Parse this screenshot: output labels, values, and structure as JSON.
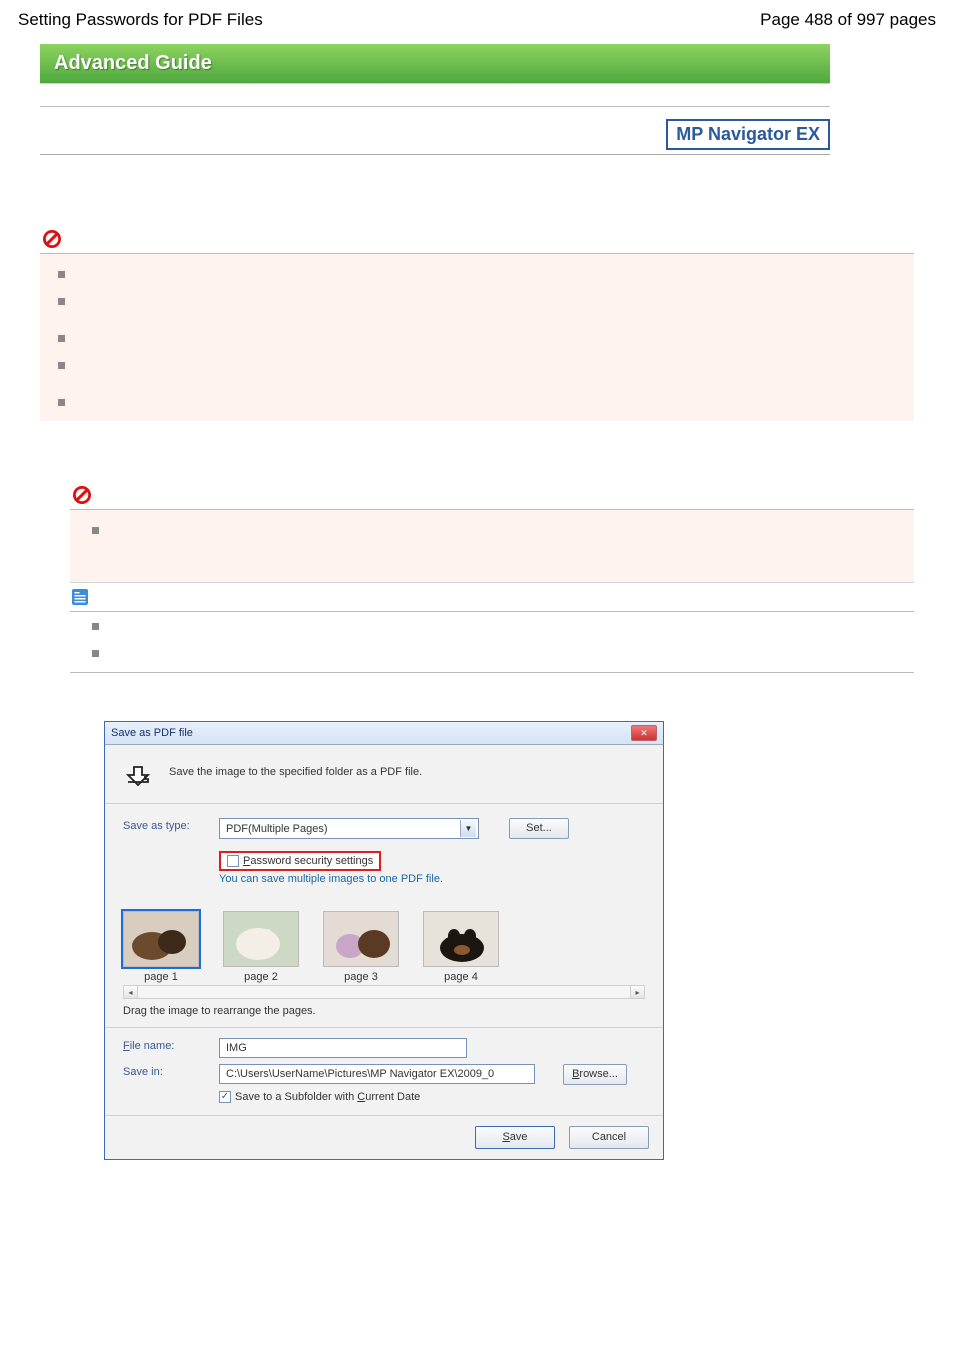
{
  "header": {
    "title": "Setting Passwords for PDF Files",
    "page_of": "Page 488 of 997 pages"
  },
  "banner": {
    "advanced_guide": "Advanced Guide",
    "mp_nav": "MP Navigator EX"
  },
  "dialog": {
    "title": "Save as PDF file",
    "header_text": "Save the image to the specified folder as a PDF file.",
    "save_as_type_label": "Save as type:",
    "save_as_type_value": "PDF(Multiple Pages)",
    "set_button": "Set...",
    "password_checkbox": "Password security settings",
    "multiple_hint": "You can save multiple images to one PDF file.",
    "pages": [
      "page 1",
      "page 2",
      "page 3",
      "page 4"
    ],
    "drag_hint": "Drag the image to rearrange the pages.",
    "file_name_label": "File name:",
    "file_name_value": "IMG",
    "save_in_label": "Save in:",
    "save_in_value": "C:\\Users\\UserName\\Pictures\\MP Navigator EX\\2009_0",
    "browse_button": "Browse...",
    "subfolder_label": "Save to a Subfolder with Current Date",
    "save_button": "Save",
    "cancel_button": "Cancel"
  }
}
